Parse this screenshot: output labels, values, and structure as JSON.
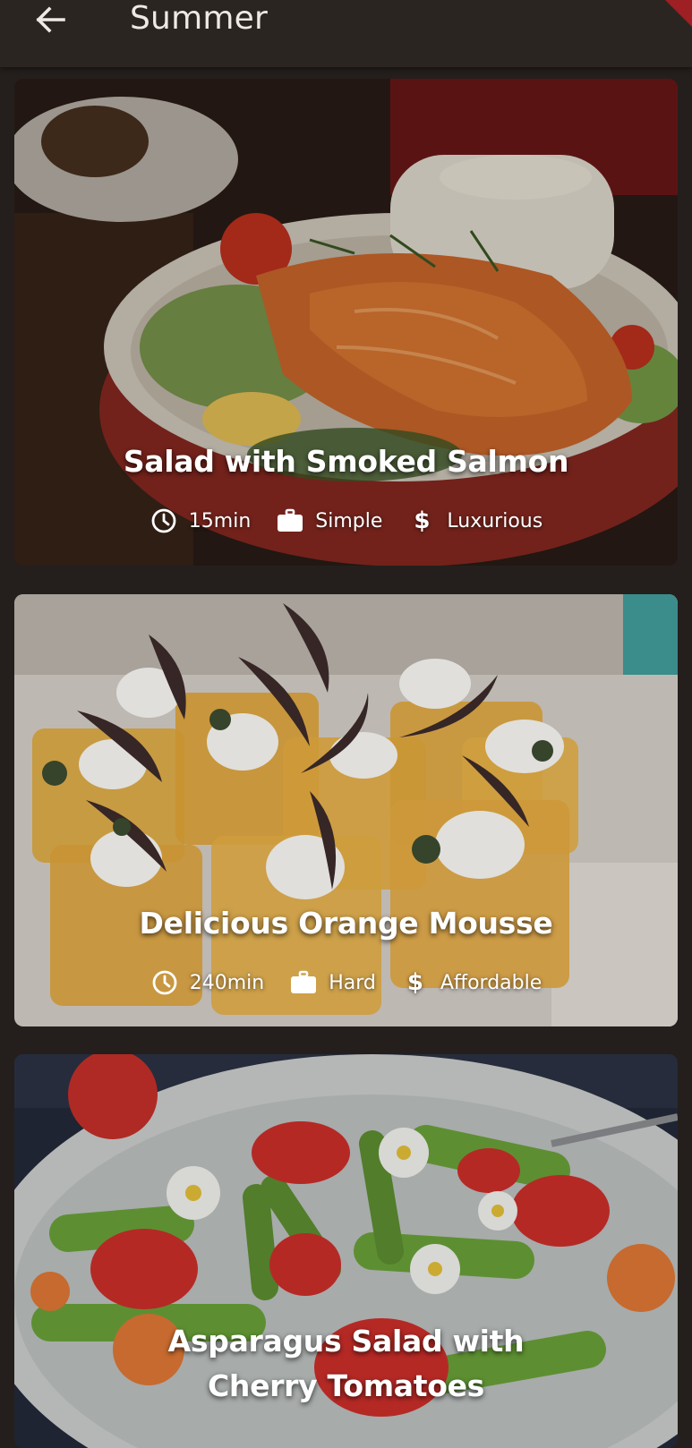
{
  "app_bar": {
    "title": "Summer",
    "back_icon": "arrow-left-icon"
  },
  "meals": [
    {
      "title": "Salad with Smoked Salmon",
      "duration": "15min",
      "complexity": "Simple",
      "affordability": "Luxurious"
    },
    {
      "title": "Delicious Orange Mousse",
      "duration": "240min",
      "complexity": "Hard",
      "affordability": "Affordable"
    },
    {
      "title": "Asparagus Salad with Cherry Tomatoes"
    }
  ],
  "icons": {
    "duration": "clock-icon",
    "complexity": "briefcase-icon",
    "affordability": "dollar-icon"
  },
  "colors": {
    "background": "#241f1c",
    "app_bar": "#2b2521",
    "text": "#ffffff"
  }
}
